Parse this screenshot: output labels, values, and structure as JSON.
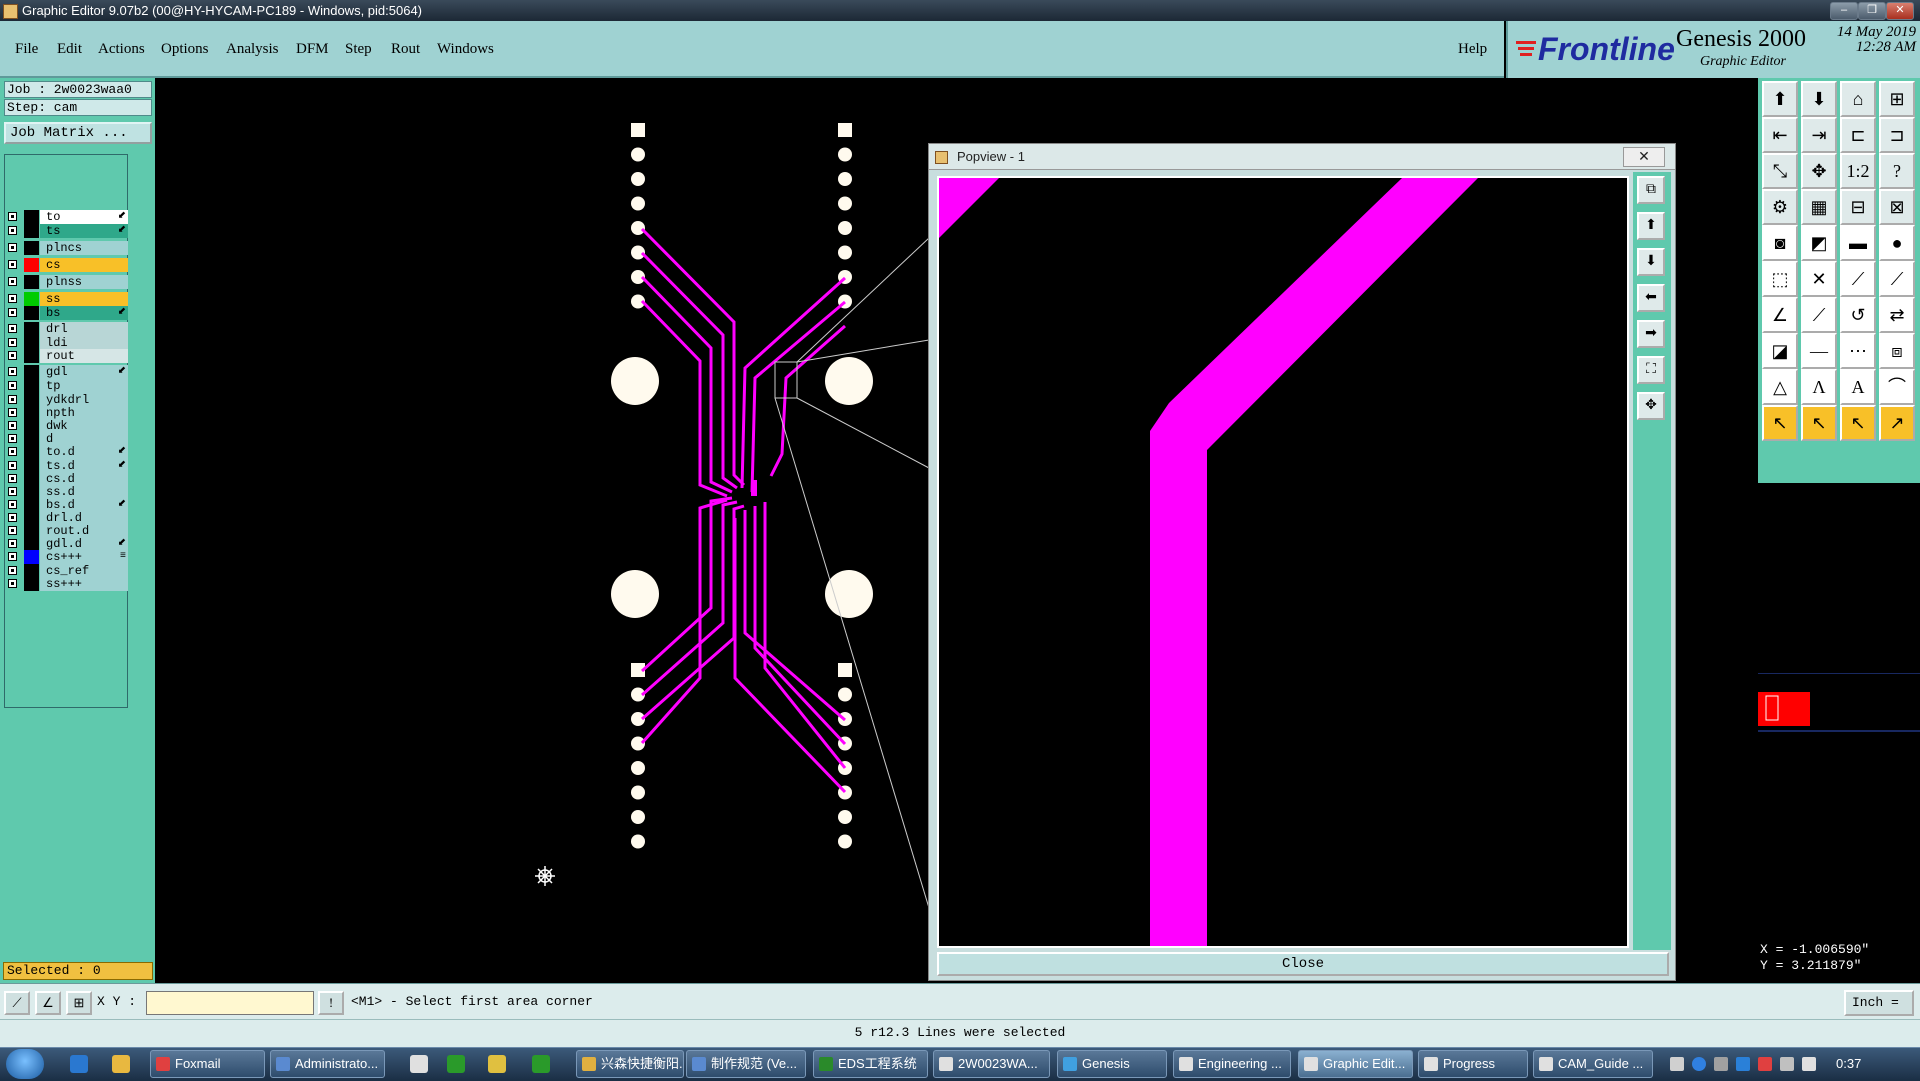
{
  "window": {
    "title": "Graphic Editor 9.07b2 (00@HY-HYCAM-PC189 - Windows, pid:5064)"
  },
  "menu": [
    "File",
    "Edit",
    "Actions",
    "Options",
    "Analysis",
    "DFM",
    "Step",
    "Rout",
    "Windows"
  ],
  "help": "Help",
  "brand": {
    "logo": "Frontline",
    "product": "Genesis 2000",
    "subtitle": "Graphic Editor",
    "date": "14 May 2019",
    "time": "12:28 AM"
  },
  "job": {
    "job": "Job : 2w0023waa0",
    "step": "Step: cam",
    "matrix_button": "Job Matrix ..."
  },
  "layers": [
    {
      "name": "to",
      "swatch": "#000000",
      "bg": "#ffffff",
      "arrow": "⬋"
    },
    {
      "name": "ts",
      "swatch": "#000000",
      "bg": "#2fa88a",
      "arrow": "⬋"
    },
    {
      "name": "plncs",
      "swatch": "#000000",
      "bg": "#9fd2d2",
      "arrow": ""
    },
    {
      "name": "cs",
      "swatch": "#ff0000",
      "bg": "#f8c028",
      "arrow": ""
    },
    {
      "name": "plnss",
      "swatch": "#000000",
      "bg": "#9fd2d2",
      "arrow": ""
    },
    {
      "name": "ss",
      "swatch": "#00cc00",
      "bg": "#f8c028",
      "arrow": ""
    },
    {
      "name": "bs",
      "swatch": "#000000",
      "bg": "#2fa88a",
      "arrow": "⬋"
    },
    {
      "name": "drl",
      "swatch": "#000000",
      "bg": "#b8d6d6",
      "arrow": ""
    },
    {
      "name": "ldi",
      "swatch": "#000000",
      "bg": "#b8d6d6",
      "arrow": ""
    },
    {
      "name": "rout",
      "swatch": "#000000",
      "bg": "#d6e6e6",
      "arrow": ""
    },
    {
      "name": "gdl",
      "swatch": "#000000",
      "bg": "#9fd2d2",
      "arrow": "⬋"
    },
    {
      "name": "tp",
      "swatch": "#000000",
      "bg": "#9fd2d2",
      "arrow": ""
    },
    {
      "name": "ydkdrl",
      "swatch": "#000000",
      "bg": "#9fd2d2",
      "arrow": ""
    },
    {
      "name": "npth",
      "swatch": "#000000",
      "bg": "#9fd2d2",
      "arrow": ""
    },
    {
      "name": "dwk",
      "swatch": "#000000",
      "bg": "#9fd2d2",
      "arrow": ""
    },
    {
      "name": "d",
      "swatch": "#000000",
      "bg": "#9fd2d2",
      "arrow": ""
    },
    {
      "name": "to.d",
      "swatch": "#000000",
      "bg": "#9fd2d2",
      "arrow": "⬋"
    },
    {
      "name": "ts.d",
      "swatch": "#000000",
      "bg": "#9fd2d2",
      "arrow": "⬋"
    },
    {
      "name": "cs.d",
      "swatch": "#000000",
      "bg": "#9fd2d2",
      "arrow": ""
    },
    {
      "name": "ss.d",
      "swatch": "#000000",
      "bg": "#9fd2d2",
      "arrow": ""
    },
    {
      "name": "bs.d",
      "swatch": "#000000",
      "bg": "#9fd2d2",
      "arrow": "⬋"
    },
    {
      "name": "drl.d",
      "swatch": "#000000",
      "bg": "#9fd2d2",
      "arrow": ""
    },
    {
      "name": "rout.d",
      "swatch": "#000000",
      "bg": "#9fd2d2",
      "arrow": ""
    },
    {
      "name": "gdl.d",
      "swatch": "#000000",
      "bg": "#9fd2d2",
      "arrow": "⬋"
    },
    {
      "name": "cs+++",
      "swatch": "#0000ff",
      "bg": "#9fd2d2",
      "arrow": "≡"
    },
    {
      "name": "cs_ref",
      "swatch": "#000000",
      "bg": "#9fd2d2",
      "arrow": ""
    },
    {
      "name": "ss+++",
      "swatch": "#000000",
      "bg": "#9fd2d2",
      "arrow": ""
    }
  ],
  "selected": "Selected : 0",
  "popview": {
    "title": "Popview - 1",
    "close_x": "✕",
    "close_button": "Close"
  },
  "coords": {
    "x": "X = -1.006590\"",
    "y": "Y = 3.211879\""
  },
  "command": {
    "xy_label": "X Y :",
    "xy_value": "",
    "prompt": "<M1> - Select first area corner",
    "unit": "Inch ="
  },
  "status": "5 r12.3 Lines were selected",
  "taskbar": {
    "tasks": [
      "Foxmail",
      "Administrato...",
      "兴森快捷衡阳...",
      "制作规范 (Ve...",
      "EDS工程系统",
      "2W0023WA...",
      "Genesis",
      "Engineering ...",
      "Graphic Edit...",
      "Progress",
      "CAM_Guide ..."
    ],
    "clock": "0:37"
  },
  "colors": {
    "trace": "#ff00ff",
    "pad": "#fffaee",
    "panel": "#5fc9ad",
    "menubar": "#9fd2d2"
  }
}
